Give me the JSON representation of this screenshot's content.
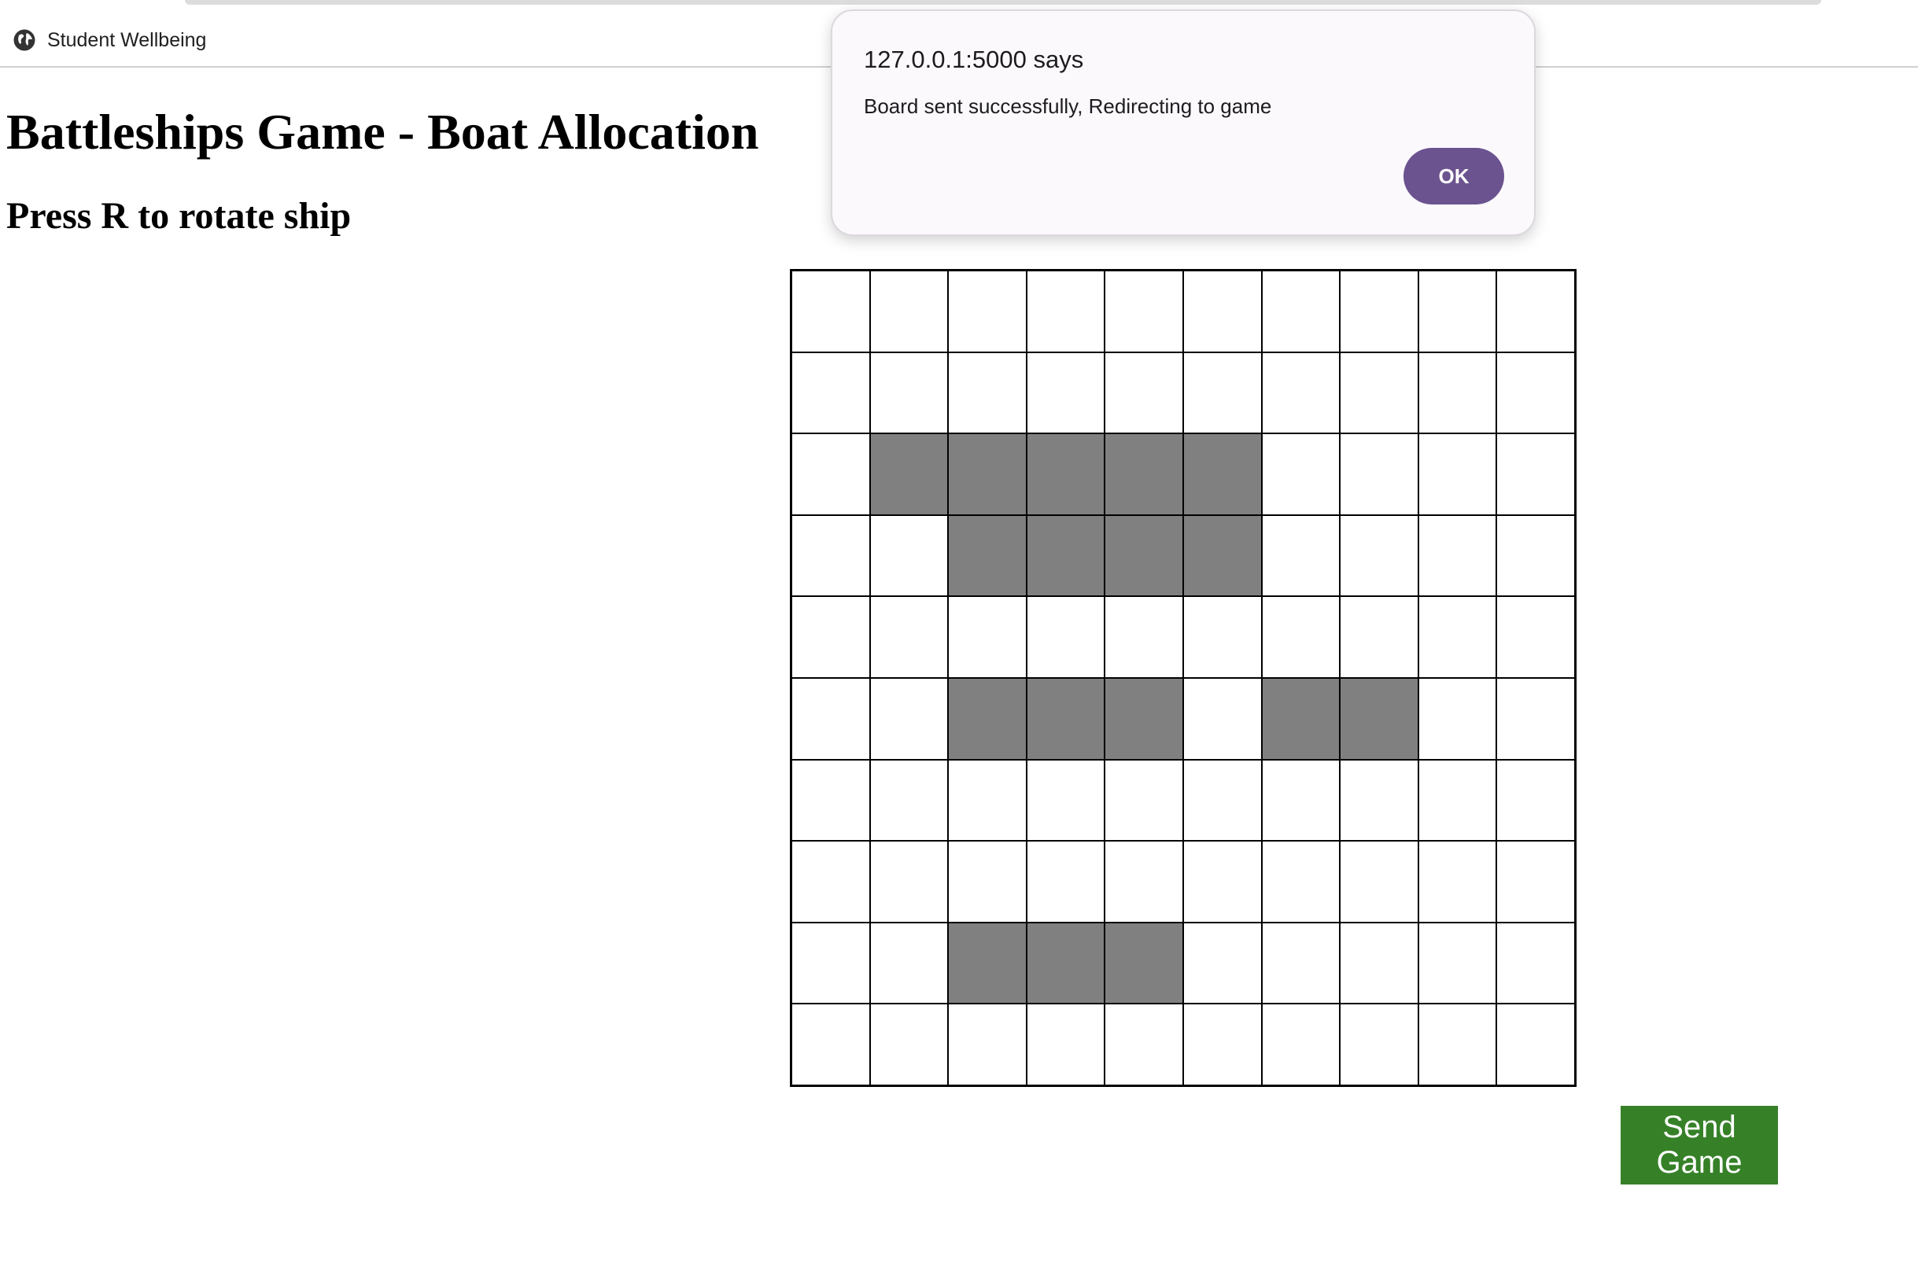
{
  "browser": {
    "bookmark_label": "Student Wellbeing",
    "bookmark_icon": "globe-icon"
  },
  "page": {
    "title": "Battleships Game - Boat Allocation",
    "subtitle": "Press R to rotate ship"
  },
  "board": {
    "rows": 10,
    "cols": 10,
    "ship_color": "#808080",
    "empty_color": "#ffffff",
    "ship_cells": [
      [
        2,
        1
      ],
      [
        2,
        2
      ],
      [
        2,
        3
      ],
      [
        2,
        4
      ],
      [
        2,
        5
      ],
      [
        3,
        2
      ],
      [
        3,
        3
      ],
      [
        3,
        4
      ],
      [
        3,
        5
      ],
      [
        5,
        2
      ],
      [
        5,
        3
      ],
      [
        5,
        4
      ],
      [
        5,
        6
      ],
      [
        5,
        7
      ],
      [
        8,
        2
      ],
      [
        8,
        3
      ],
      [
        8,
        4
      ]
    ]
  },
  "send_button": {
    "label": "Send\nGame",
    "color": "#368128"
  },
  "dialog": {
    "title": "127.0.0.1:5000 says",
    "message": "Board sent successfully, Redirecting to game",
    "ok_label": "OK",
    "ok_color": "#6b538f"
  }
}
